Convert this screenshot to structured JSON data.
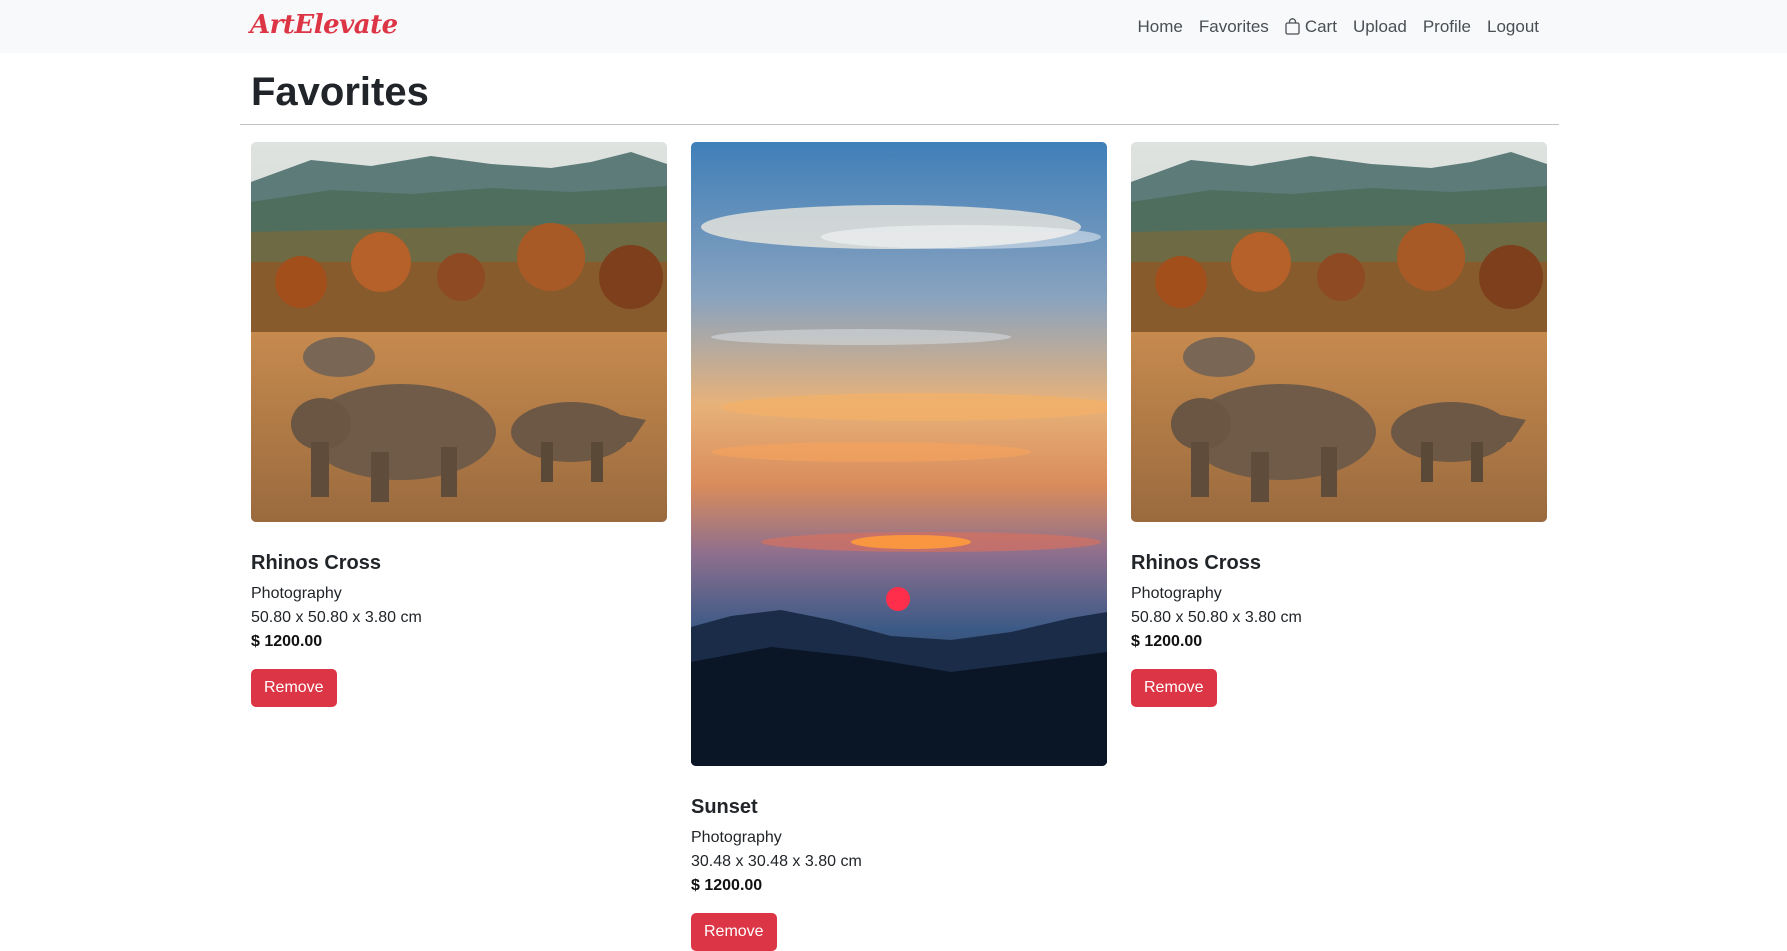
{
  "navbar": {
    "brand": "ArtElevate",
    "links": {
      "home": "Home",
      "favorites": "Favorites",
      "cart": "Cart",
      "upload": "Upload",
      "profile": "Profile",
      "logout": "Logout"
    }
  },
  "page": {
    "title": "Favorites"
  },
  "favorites": [
    {
      "title": "Rhinos Cross",
      "category": "Photography",
      "dimensions": "50.80 x 50.80 x 3.80 cm",
      "price": "$ 1200.00",
      "button": "Remove"
    },
    {
      "title": "Sunset",
      "category": "Photography",
      "dimensions": "30.48 x 30.48 x 3.80 cm",
      "price": "$ 1200.00",
      "button": "Remove"
    },
    {
      "title": "Rhinos Cross",
      "category": "Photography",
      "dimensions": "50.80 x 50.80 x 3.80 cm",
      "price": "$ 1200.00",
      "button": "Remove"
    }
  ],
  "colors": {
    "brand": "#dc3545",
    "navbar_bg": "#f8f9fa",
    "remove_button": "#dc3545"
  },
  "icons": {
    "cart": "shopping-bag-icon"
  }
}
